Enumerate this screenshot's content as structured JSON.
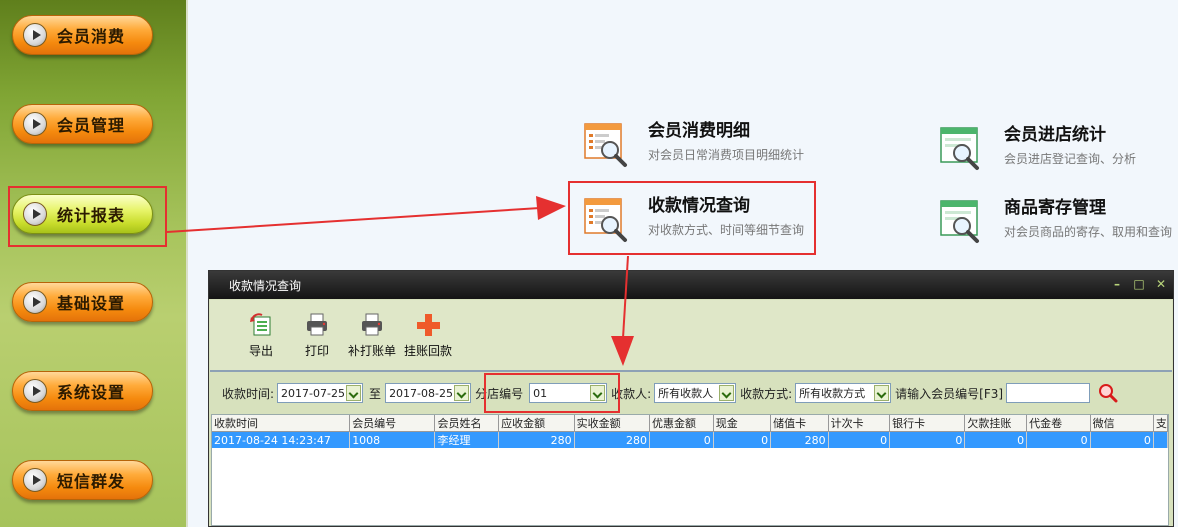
{
  "sidebar": {
    "items": [
      {
        "label": "会员消费"
      },
      {
        "label": "会员管理"
      },
      {
        "label": "统计报表"
      },
      {
        "label": "基础设置"
      },
      {
        "label": "系统设置"
      },
      {
        "label": "短信群发"
      }
    ]
  },
  "main": {
    "entries": [
      {
        "title": "会员消费明细",
        "desc": "对会员日常消费项目明细统计"
      },
      {
        "title": "会员进店统计",
        "desc": "会员进店登记查询、分析"
      },
      {
        "title": "收款情况查询",
        "desc": "对收款方式、时间等细节查询"
      },
      {
        "title": "商品寄存管理",
        "desc": "对会员商品的寄存、取用和查询"
      }
    ]
  },
  "dialog": {
    "title": "收款情况查询",
    "controls": {
      "min": "–",
      "max": "□",
      "close": "✕"
    },
    "toolbar": [
      {
        "label": "导出",
        "icon": "excel-export-icon"
      },
      {
        "label": "打印",
        "icon": "printer-icon"
      },
      {
        "label": "补打账单",
        "icon": "printer-icon"
      },
      {
        "label": "挂账回款",
        "icon": "plus-icon"
      }
    ],
    "filters": {
      "time_label": "收款时间:",
      "date_from": "2017-07-25",
      "to_label": "至",
      "date_to": "2017-08-25",
      "branch_label": "分店编号",
      "branch_value": "01",
      "payee_label": "收款人:",
      "payee_value": "所有收款人",
      "method_label": "收款方式:",
      "method_value": "所有收款方式",
      "member_label": "请输入会员编号[F3]",
      "member_value": ""
    },
    "table": {
      "columns": [
        "收款时间",
        "会员编号",
        "会员姓名",
        "应收金额",
        "实收金额",
        "优惠金额",
        "现金",
        "储值卡",
        "计次卡",
        "银行卡",
        "欠款挂账",
        "代金卷",
        "微信",
        "支"
      ],
      "rows": [
        [
          "2017-08-24 14:23:47",
          "1008",
          "李经理",
          "280",
          "280",
          "0",
          "0",
          "280",
          "0",
          "0",
          "0",
          "0",
          "0",
          ""
        ]
      ]
    }
  },
  "colors": {
    "accent_red": "#e53030",
    "selection": "#3399ff",
    "sidebar_green": "#80a534",
    "button_orange": "#f58a0e"
  }
}
